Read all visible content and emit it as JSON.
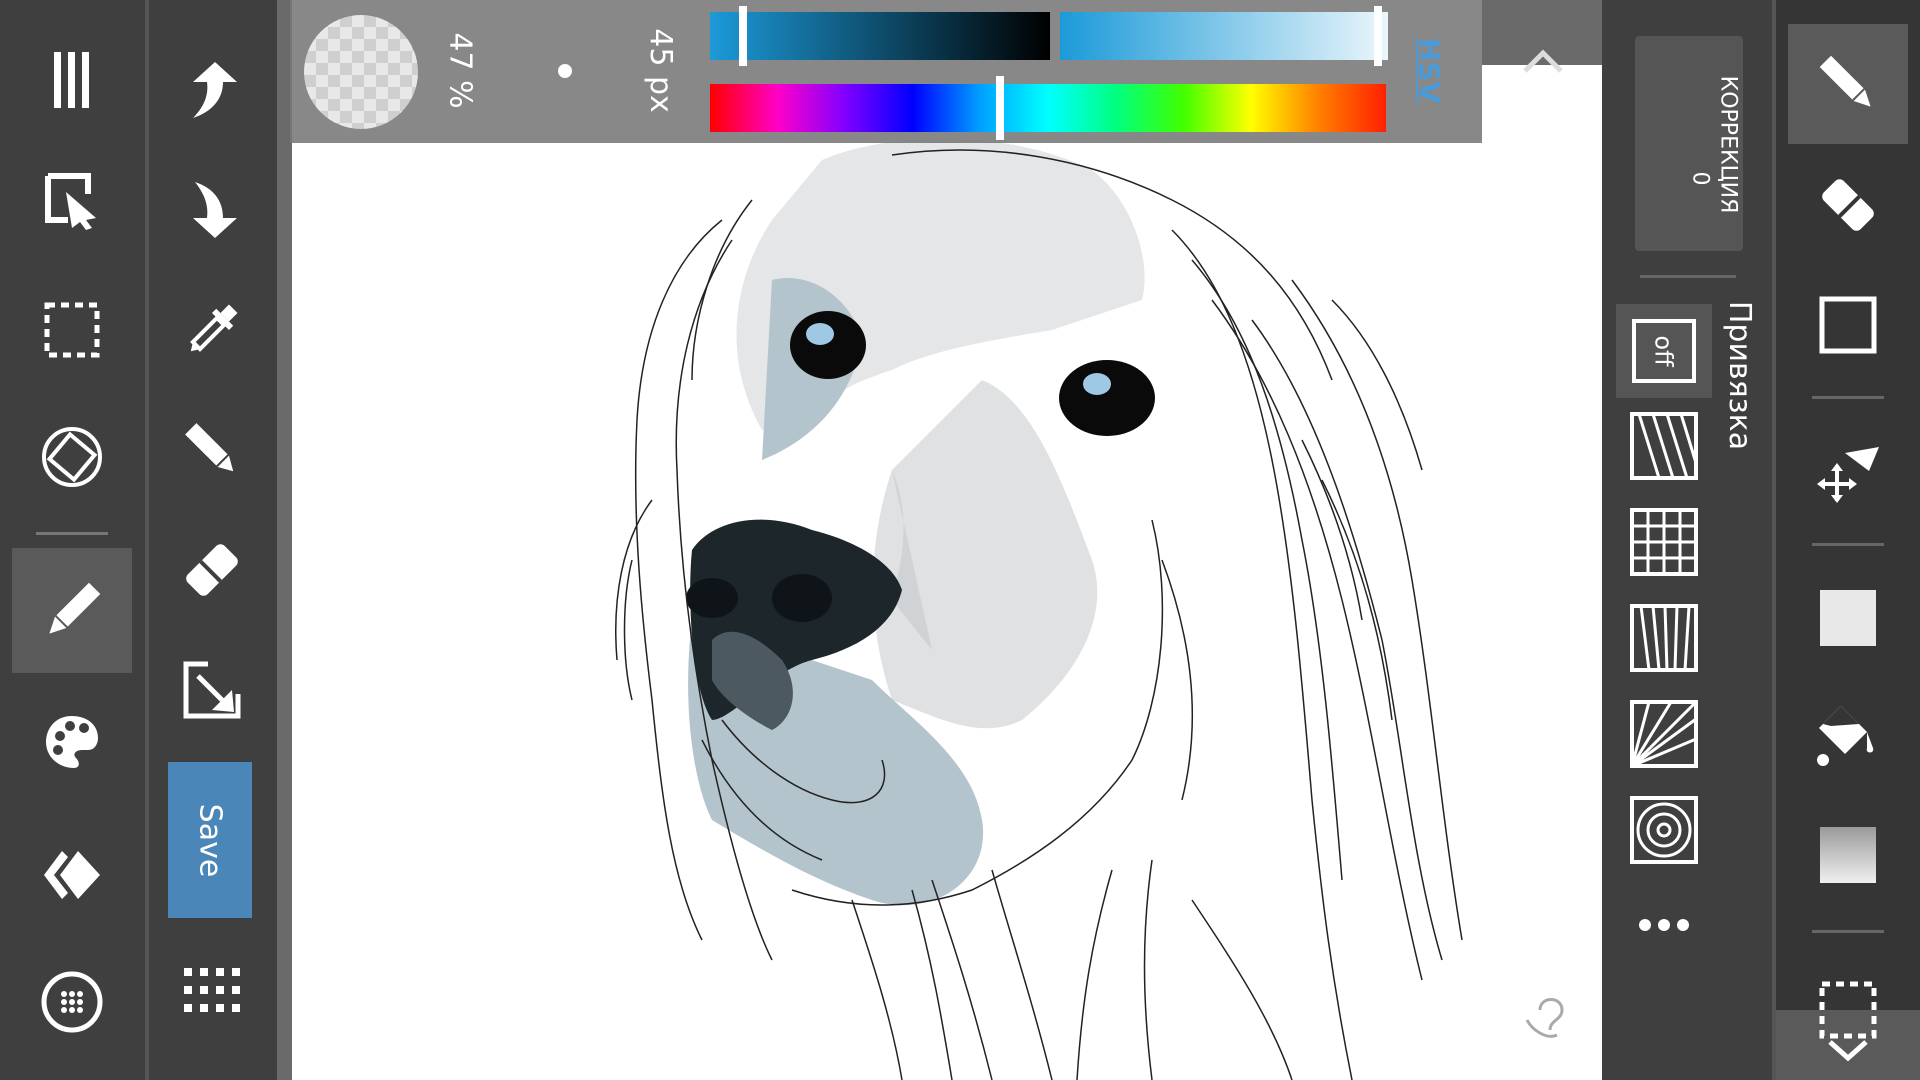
{
  "toolbar": {
    "opacity_text": "47 %",
    "size_text": "45 px",
    "color_mode_label": "HSV",
    "save_label": "Save"
  },
  "correction": {
    "label": "КОРРЕКЦИЯ",
    "value": "0"
  },
  "snap": {
    "label": "Привязка",
    "off_label": "off"
  },
  "sliders": {
    "saturation_position": 0.05,
    "value_position": 0.97,
    "hue_position": 0.43
  },
  "colors": {
    "accent_blue": "#4a86b8",
    "panel_dark": "#3f3f3f",
    "active_tool": "#5a5a5a"
  },
  "left_tools": [
    "menu-icon",
    "select-edit-icon",
    "rect-select-icon",
    "rotate-canvas-icon",
    "brush-icon",
    "palette-icon",
    "layers-icon",
    "settings-icon"
  ],
  "second_tools": [
    "redo-icon",
    "undo-icon",
    "dropper-icon",
    "pencil-icon",
    "eraser-icon",
    "resize-icon",
    "save-button",
    "grid-dots-icon"
  ],
  "right_tools": [
    "pen-icon",
    "eraser-icon",
    "rectangle-icon",
    "transform-icon",
    "fill-square-icon",
    "bucket-icon",
    "gradient-icon",
    "selection-icon"
  ],
  "snap_modes": [
    "snap-off",
    "parallel-lines",
    "grid",
    "perspective",
    "radial-lines",
    "concentric"
  ]
}
